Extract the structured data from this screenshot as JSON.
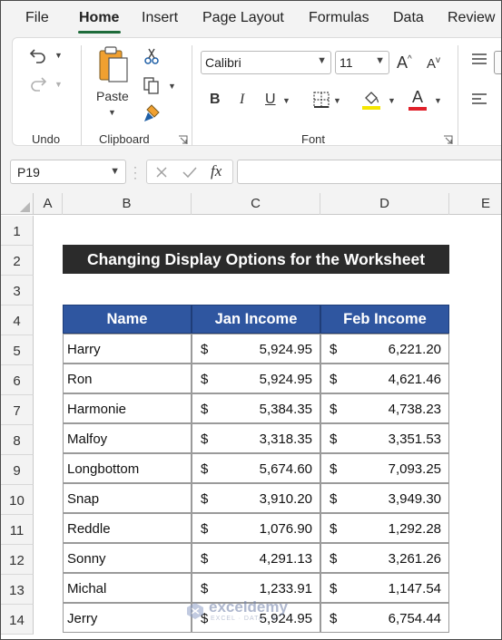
{
  "menu": {
    "tabs": [
      "File",
      "Home",
      "Insert",
      "Page Layout",
      "Formulas",
      "Data",
      "Review"
    ],
    "active": "Home"
  },
  "ribbon": {
    "undo_group": {
      "label": "Undo"
    },
    "clipboard_group": {
      "label": "Clipboard",
      "paste_label": "Paste"
    },
    "font_group": {
      "label": "Font",
      "font_name": "Calibri",
      "font_size": "11",
      "bold": "B",
      "italic": "I",
      "underline": "U",
      "font_color_letter": "A",
      "highlight_color": "#f5e600",
      "font_color": "#e0202a"
    }
  },
  "formula_bar": {
    "name_box": "P19",
    "fx_label": "fx",
    "formula": ""
  },
  "sheet": {
    "columns": [
      "A",
      "B",
      "C",
      "D",
      "E"
    ],
    "rows": [
      "1",
      "2",
      "3",
      "4",
      "5",
      "6",
      "7",
      "8",
      "9",
      "10",
      "11",
      "12",
      "13",
      "14"
    ],
    "title": "Changing Display Options for the Worksheet",
    "headers": [
      "Name",
      "Jan Income",
      "Feb Income"
    ],
    "currency_symbol": "$",
    "data": [
      {
        "name": "Harry",
        "jan": "5,924.95",
        "feb": "6,221.20"
      },
      {
        "name": "Ron",
        "jan": "5,924.95",
        "feb": "4,621.46"
      },
      {
        "name": "Harmonie",
        "jan": "5,384.35",
        "feb": "4,738.23"
      },
      {
        "name": "Malfoy",
        "jan": "3,318.35",
        "feb": "3,351.53"
      },
      {
        "name": "Longbottom",
        "jan": "5,674.60",
        "feb": "7,093.25"
      },
      {
        "name": "Snap",
        "jan": "3,910.20",
        "feb": "3,949.30"
      },
      {
        "name": "Reddle",
        "jan": "1,076.90",
        "feb": "1,292.28"
      },
      {
        "name": "Sonny",
        "jan": "4,291.13",
        "feb": "3,261.26"
      },
      {
        "name": "Michal",
        "jan": "1,233.91",
        "feb": "1,147.54"
      },
      {
        "name": "Jerry",
        "jan": "5,924.95",
        "feb": "6,754.44"
      }
    ],
    "header_fill": "#2f56a0",
    "title_fill": "#2b2b2b"
  },
  "watermark": {
    "name": "exceldemy",
    "tagline": "EXCEL · DATA · BI"
  }
}
